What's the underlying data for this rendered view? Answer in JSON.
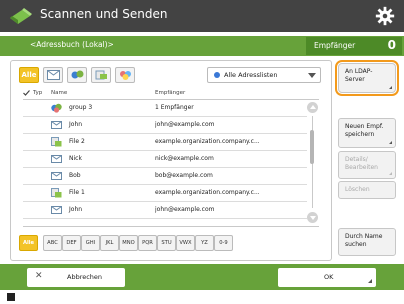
{
  "header": {
    "title": "Scannen und Senden",
    "logo": "scan-send-app-icon",
    "settings_icon": "gear-icon"
  },
  "address_bar": {
    "address_book_label": "<Adressbuch (Lokal)>",
    "recipients_label": "Empfänger",
    "recipients_count": "0"
  },
  "filters": {
    "all_label": "Alle",
    "icons": [
      "email-icon",
      "group-icon",
      "file-icon",
      "ifax-icon"
    ],
    "address_list": "Alle Adresslisten"
  },
  "table": {
    "columns": {
      "type": "Typ",
      "name": "Name",
      "recipient": "Empfänger"
    },
    "rows": [
      {
        "icon": "group-icon",
        "name": "group 3",
        "recipient": "1 Empfänger"
      },
      {
        "icon": "email-icon",
        "name": "John",
        "recipient": "john@example.com"
      },
      {
        "icon": "file-icon",
        "name": "File 2",
        "recipient": "example.organization.company.c..."
      },
      {
        "icon": "email-icon",
        "name": "Nick",
        "recipient": "nick@example.com"
      },
      {
        "icon": "email-icon",
        "name": "Bob",
        "recipient": "bob@example.com"
      },
      {
        "icon": "file-icon",
        "name": "File 1",
        "recipient": "example.organization.company.c..."
      },
      {
        "icon": "email-icon",
        "name": "John",
        "recipient": "john@example.com"
      }
    ]
  },
  "alphabet_tabs": [
    "Alle",
    "ABC",
    "DEF",
    "GHI",
    "JKL",
    "MNO",
    "PQR",
    "STU",
    "VWX",
    "YZ",
    "0-9"
  ],
  "side_buttons": {
    "ldap": "An LDAP-\nServer",
    "new_recipient": "Neuen Empf.\nspeichern",
    "edit_details": "Details/\nBearbeiten",
    "delete": "Löschen",
    "search_by_name": "Durch Name\nsuchen"
  },
  "bottom": {
    "cancel": "Abbrechen",
    "ok": "OK"
  },
  "colors": {
    "header_bg": "#434343",
    "accent_green": "#67a23a",
    "highlight_yellow": "#f3c327",
    "focus_orange": "#f39a1c"
  }
}
